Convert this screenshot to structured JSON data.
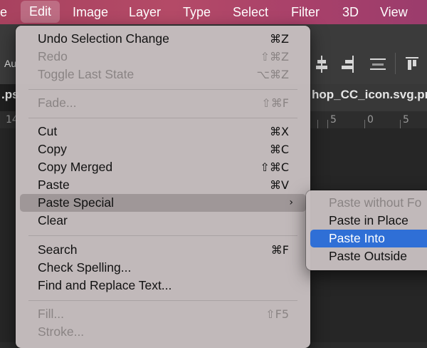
{
  "menubar": {
    "items": [
      {
        "label": "e"
      },
      {
        "label": "Edit"
      },
      {
        "label": "Image"
      },
      {
        "label": "Layer"
      },
      {
        "label": "Type"
      },
      {
        "label": "Select"
      },
      {
        "label": "Filter"
      },
      {
        "label": "3D"
      },
      {
        "label": "View"
      }
    ]
  },
  "options_bar": {
    "left_label": "Au"
  },
  "tabs": {
    "left_fragment": ".ps",
    "active_tab": "hop_CC_icon.svg.png"
  },
  "ruler": {
    "left_number": "14",
    "right_numbers": [
      "5",
      "0",
      "5"
    ]
  },
  "edit_menu": {
    "items": [
      {
        "label": "Undo Selection Change",
        "shortcut": "⌘Z",
        "disabled": false
      },
      {
        "label": "Redo",
        "shortcut": "⇧⌘Z",
        "disabled": true
      },
      {
        "label": "Toggle Last State",
        "shortcut": "⌥⌘Z",
        "disabled": true
      },
      {
        "label": "Fade...",
        "shortcut": "⇧⌘F",
        "disabled": true
      },
      {
        "label": "Cut",
        "shortcut": "⌘X",
        "disabled": false
      },
      {
        "label": "Copy",
        "shortcut": "⌘C",
        "disabled": false
      },
      {
        "label": "Copy Merged",
        "shortcut": "⇧⌘C",
        "disabled": false
      },
      {
        "label": "Paste",
        "shortcut": "⌘V",
        "disabled": false
      },
      {
        "label": "Paste Special",
        "shortcut": "›",
        "disabled": false
      },
      {
        "label": "Clear",
        "shortcut": "",
        "disabled": false
      },
      {
        "label": "Search",
        "shortcut": "⌘F",
        "disabled": false
      },
      {
        "label": "Check Spelling...",
        "shortcut": "",
        "disabled": false
      },
      {
        "label": "Find and Replace Text...",
        "shortcut": "",
        "disabled": false
      },
      {
        "label": "Fill...",
        "shortcut": "⇧F5",
        "disabled": true
      },
      {
        "label": "Stroke...",
        "shortcut": "",
        "disabled": true
      }
    ]
  },
  "paste_special_submenu": {
    "items": [
      {
        "label": "Paste without Fo",
        "disabled": true
      },
      {
        "label": "Paste in Place",
        "disabled": false
      },
      {
        "label": "Paste Into",
        "disabled": false,
        "selected": true
      },
      {
        "label": "Paste Outside",
        "disabled": false
      }
    ]
  },
  "colors": {
    "menubar": "#b04664",
    "highlight": "#2f6fd6",
    "menu_bg": "#c6bebf"
  }
}
